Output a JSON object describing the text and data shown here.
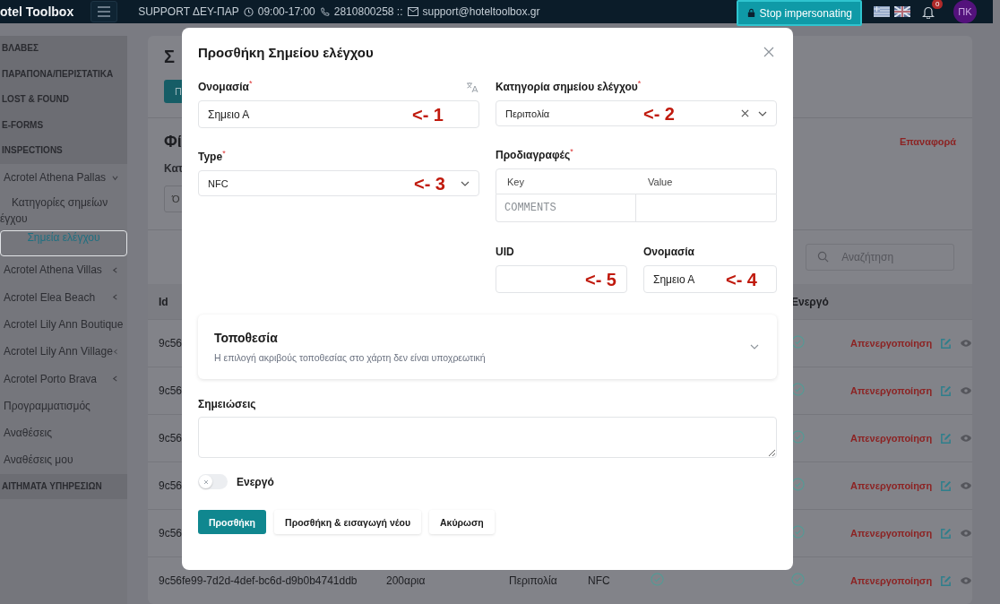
{
  "header": {
    "logo": "otel Toolbox",
    "support": {
      "label": "SUPPORT ΔΕΥ-ΠΑΡ",
      "hours": "09:00-17:00",
      "phone": "2810800258 ::",
      "email": "support@hoteltoolbox.gr"
    },
    "stop_button": "Stop impersonating",
    "notifications_count": "0",
    "avatar_initials": "ΠΚ"
  },
  "sidebar": {
    "items": [
      {
        "label": "ΒΛΑΒΕΣ",
        "kind": "section",
        "selected": false
      },
      {
        "label": "ΠΑΡΑΠΟΝΑ/ΠΕΡΙΣΤΑΤΙΚΑ",
        "kind": "section",
        "selected": false
      },
      {
        "label": "LOST & FOUND",
        "kind": "section",
        "selected": false
      },
      {
        "label": "E-FORMS",
        "kind": "section",
        "selected": false
      },
      {
        "label": "INSPECTIONS",
        "kind": "section",
        "selected": false
      },
      {
        "label": "Acrotel Athena Pallas",
        "kind": "group",
        "expanded": true,
        "selected": false,
        "children": [
          {
            "label": "Κατηγορίες σημείων",
            "label_2": "έγχου",
            "selected": false
          },
          {
            "label": "Σημεία ελέγχου",
            "selected": true
          }
        ]
      },
      {
        "label": "Acrotel Athena Villas",
        "kind": "group",
        "expanded": false,
        "selected": false
      },
      {
        "label": "Acrotel Elea Beach",
        "kind": "group",
        "expanded": false,
        "selected": false
      },
      {
        "label": "Acrotel Lily Ann Boutique",
        "kind": "link",
        "selected": false
      },
      {
        "label": "Acrotel Lily Ann Village",
        "kind": "group",
        "expanded": false,
        "selected": false
      },
      {
        "label": "Acrotel Porto Brava",
        "kind": "group",
        "expanded": false,
        "selected": false
      },
      {
        "label": "Προγραμματισμός",
        "kind": "link",
        "selected": false
      },
      {
        "label": "Αναθέσεις",
        "kind": "link",
        "selected": false
      },
      {
        "label": "Αναθέσεις μου",
        "kind": "link",
        "selected": false
      },
      {
        "label": "ΑΙΤΗΜΑΤΑ ΥΠΗΡΕΣΙΩΝ",
        "kind": "section",
        "selected": false
      }
    ]
  },
  "page": {
    "title": "Σ",
    "add_button": "Π",
    "filters_title": "Φί",
    "filter_label": "Κατ",
    "filter_value": "Ό",
    "reset_link": "Επαναφορά",
    "search_placeholder": "Αναζήτηση",
    "table": {
      "columns": [
        "Id",
        "Ενεργό"
      ],
      "rows": [
        {
          "id": "9c56",
          "active": true,
          "action": "Απενεργοποίηση"
        },
        {
          "id": "9c56",
          "active": true,
          "action": "Απενεργοποίηση"
        },
        {
          "id": "9c56",
          "active": true,
          "action": "Απενεργοποίηση"
        },
        {
          "id": "9c56",
          "active": true,
          "action": "Απενεργοποίηση"
        },
        {
          "id": "9c56",
          "active": true,
          "action": "Απενεργοποίηση"
        },
        {
          "id": "9c56fe99-7d2d-4def-bc6d-d9b0b4741ddb",
          "column_2": "200αρια",
          "column_3": "Περιπολία",
          "column_4": "NFC",
          "column_5_checked": true,
          "active": true,
          "action": "Απενεργοποίηση"
        }
      ]
    }
  },
  "modal": {
    "title": "Προσθήκη Σημείου ελέγχου",
    "name_field": {
      "label": "Ονομασία",
      "required_mark": "*",
      "value": "Σημειο Α",
      "annotation": "<- 1"
    },
    "category_field": {
      "label": "Κατηγορία σημείου ελέγχου",
      "required_mark": "*",
      "value": "Περιπολία",
      "clearable": true,
      "annotation": "<- 2"
    },
    "type_field": {
      "label": "Type",
      "required_mark": "*",
      "value": "NFC",
      "clearable": false,
      "annotation": "<- 3"
    },
    "specs": {
      "label": "Προδιαγραφές",
      "required_mark": "*",
      "columns": [
        "Key",
        "Value"
      ],
      "rows": [
        {
          "key_placeholder": "COMMENTS"
        }
      ]
    },
    "uid_field": {
      "label": "UID",
      "annotation": "<- 5"
    },
    "name_copy_field": {
      "label": "Ονομασία",
      "value": "Σημειο Α",
      "annotation": "<- 4"
    },
    "location": {
      "title": "Τοποθεσία",
      "hint": "Η επιλογή ακριβούς τοποθεσίας στο χάρτη δεν είναι υποχρεωτική",
      "expanded": false
    },
    "notes": {
      "label": "Σημειώσεις"
    },
    "active_toggle": {
      "label": "Ενεργό",
      "on": false
    },
    "buttons": [
      {
        "label": "Προσθήκη",
        "kind": "primary"
      },
      {
        "label": "Προσθήκη & εισαγωγή νέου",
        "kind": "secondary"
      },
      {
        "label": "Ακύρωση",
        "kind": "secondary"
      }
    ]
  }
}
